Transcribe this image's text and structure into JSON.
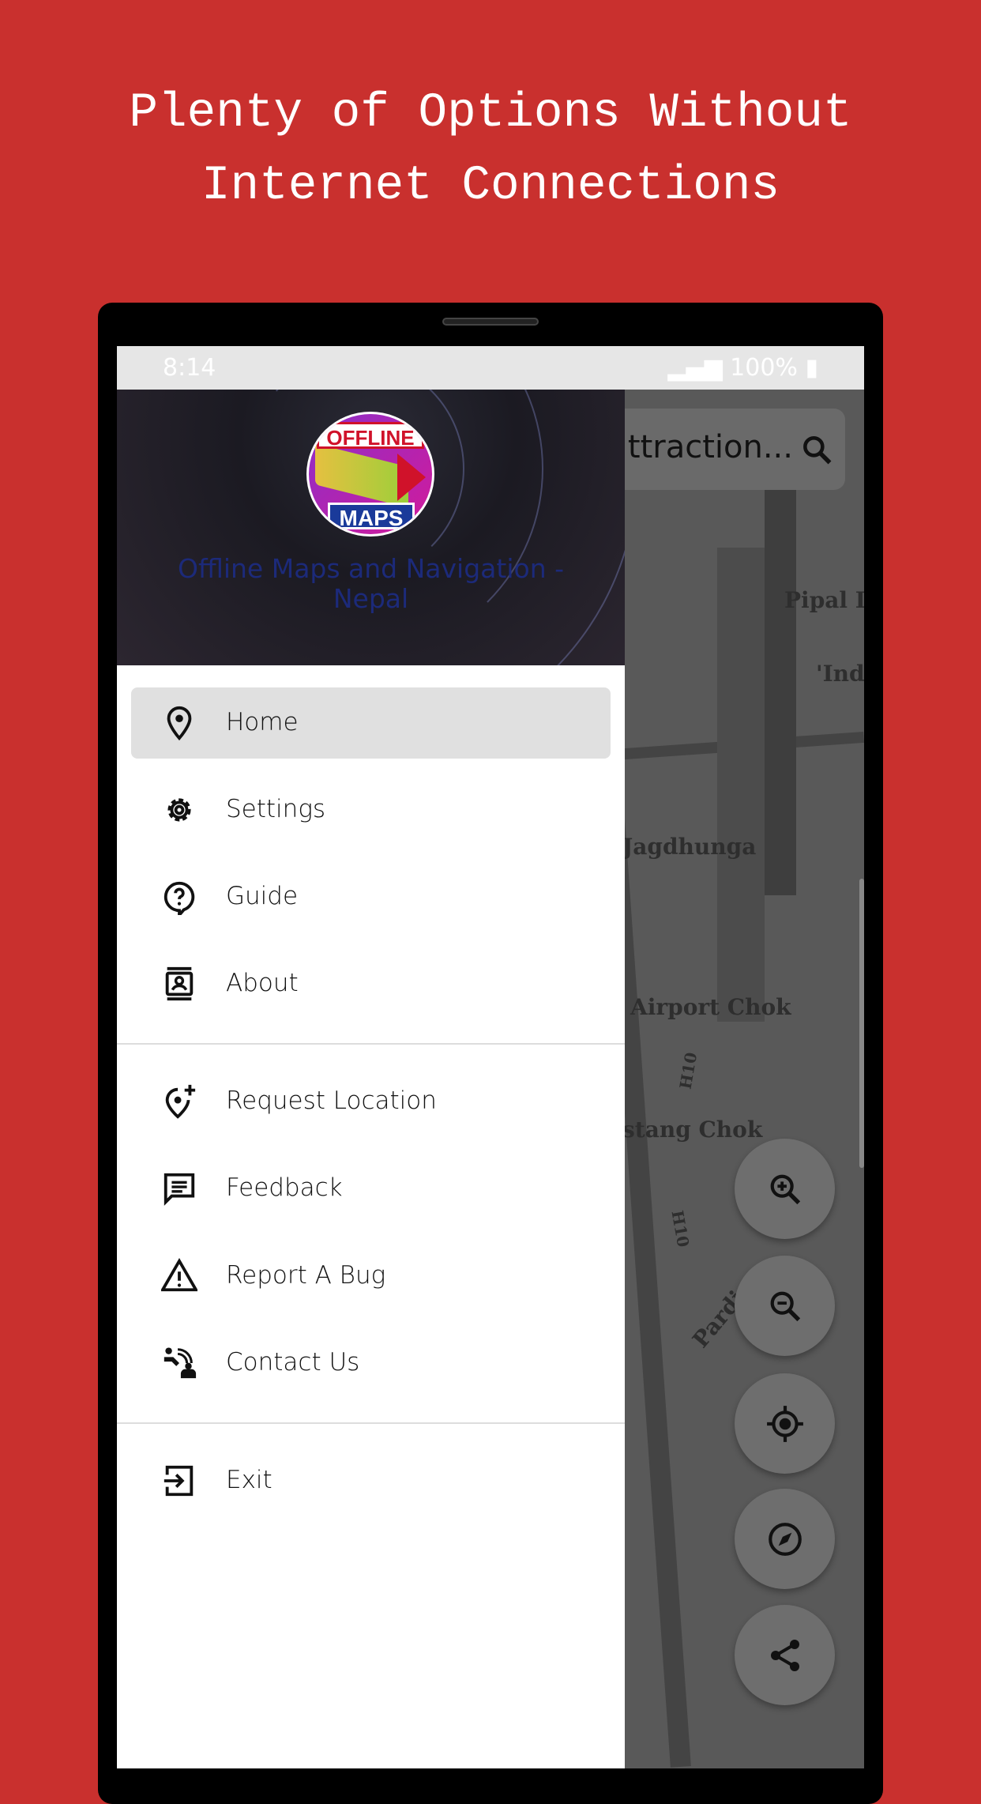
{
  "headline": {
    "line1": "Plenty of Options Without",
    "line2": "Internet Connections"
  },
  "colors": {
    "background": "#c9302e",
    "drawer_active": "#e0e0e0",
    "app_name": "#1c2a7a"
  },
  "status_bar": {
    "time": "8:14",
    "battery": "100%"
  },
  "drawer": {
    "logo": {
      "top_text": "OFFLINE",
      "bottom_text": "MAPS"
    },
    "app_name": "Offline Maps and Navigation - Nepal",
    "groups": [
      [
        {
          "label": "Home",
          "icon": "map-pin-icon",
          "active": true
        },
        {
          "label": "Settings",
          "icon": "gear-icon"
        },
        {
          "label": "Guide",
          "icon": "help-icon"
        },
        {
          "label": "About",
          "icon": "contact-card-icon"
        }
      ],
      [
        {
          "label": "Request Location",
          "icon": "add-location-icon"
        },
        {
          "label": "Feedback",
          "icon": "feedback-icon"
        },
        {
          "label": "Report A Bug",
          "icon": "warning-icon"
        },
        {
          "label": "Contact Us",
          "icon": "contact-icon"
        }
      ],
      [
        {
          "label": "Exit",
          "icon": "exit-icon"
        }
      ]
    ]
  },
  "search": {
    "text": "ttraction..."
  },
  "map": {
    "labels": [
      "Pipal Do",
      "'Indr",
      "Jagdhunga",
      "Airport Chok",
      "H10",
      "stang Chok",
      "H10",
      "Pardi"
    ]
  },
  "fabs": [
    "zoom-in-icon",
    "zoom-out-icon",
    "my-location-icon",
    "compass-icon",
    "share-icon"
  ]
}
